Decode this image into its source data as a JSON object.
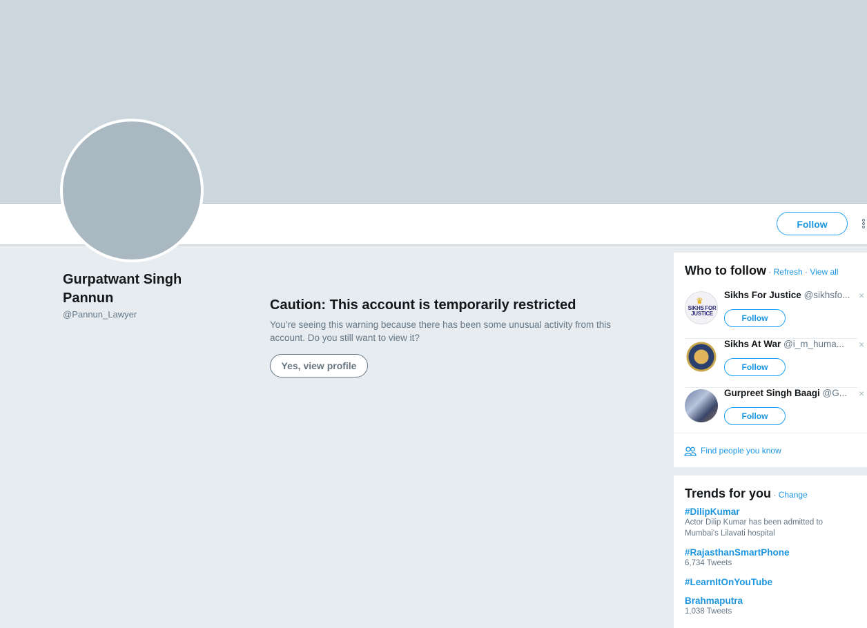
{
  "profile": {
    "name": "Gurpatwant Singh Pannun",
    "handle": "@Pannun_Lawyer",
    "follow_label": "Follow"
  },
  "caution": {
    "title": "Caution: This account is temporarily restricted",
    "message": "You’re seeing this warning because there has been some unusual activity from this account. Do you still want to view it?",
    "button_label": "Yes, view profile"
  },
  "who_to_follow": {
    "title": "Who to follow",
    "sep1": " · ",
    "refresh": "Refresh",
    "sep2": " · ",
    "view_all": "View all",
    "users": [
      {
        "name": "Sikhs For Justice",
        "handle": "@sikhsfo...",
        "follow_label": "Follow",
        "close": "×",
        "avatar_text_top": "♛",
        "avatar_text": "SIKHS FOR JUSTICE"
      },
      {
        "name": "Sikhs At War",
        "handle": "@i_m_huma...",
        "follow_label": "Follow",
        "close": "×"
      },
      {
        "name": "Gurpreet Singh Baagi",
        "handle": "@G...",
        "follow_label": "Follow",
        "close": "×"
      }
    ],
    "find_people": "Find people you know"
  },
  "trends": {
    "title": "Trends for you",
    "sep": " · ",
    "change": "Change",
    "items": [
      {
        "tag": "#DilipKumar",
        "desc": "Actor Dilip Kumar has been admitted to Mumbai's Lilavati hospital"
      },
      {
        "tag": "#RajasthanSmartPhone",
        "desc": "6,734 Tweets"
      },
      {
        "tag": "#LearnItOnYouTube",
        "desc": ""
      },
      {
        "tag": "Brahmaputra",
        "desc": "1,038 Tweets"
      }
    ]
  },
  "colors": {
    "accent": "#1da1f2",
    "link": "#1b95e0",
    "banner": "#ccd6dd",
    "avatar": "#aab8c2",
    "page_bg": "#e6ecf0"
  },
  "icons": [
    "more-dots-icon",
    "close-icon",
    "people-icon"
  ]
}
